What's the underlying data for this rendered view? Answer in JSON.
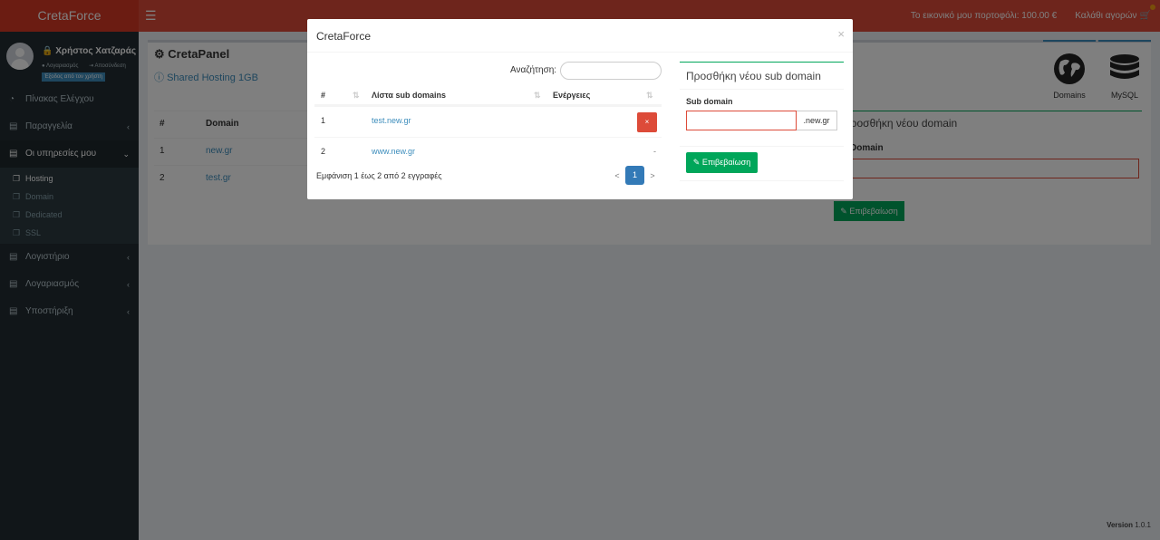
{
  "header": {
    "brand": "CretaForce",
    "portfolio": "Το εικονικό μου πορτοφόλι: 100.00 €",
    "cart": "Καλάθι αγορών"
  },
  "sidebar": {
    "user_name": "Χρήστος Χατζαράς",
    "account_link": "Λογαριασμός",
    "logout_link": "Αποσύνδεση",
    "exit_badge": "Έξοδος από τον χρήστη",
    "items": [
      {
        "label": "Πίνακας Ελέγχου"
      },
      {
        "label": "Παραγγελία"
      },
      {
        "label": "Οι υπηρεσίες μου"
      },
      {
        "label": "Λογιστήριο"
      },
      {
        "label": "Λογαριασμός"
      },
      {
        "label": "Υποστήριξη"
      }
    ],
    "subitems": [
      {
        "label": "Hosting"
      },
      {
        "label": "Domain"
      },
      {
        "label": "Dedicated"
      },
      {
        "label": "SSL"
      }
    ]
  },
  "background": {
    "panel_title": "CretaPanel",
    "panel_subtitle": "Shared Hosting 1GB",
    "table": {
      "col_num": "#",
      "col_domain": "Domain",
      "rows": [
        {
          "num": "1",
          "domain": "new.gr"
        },
        {
          "num": "2",
          "domain": "test.gr"
        }
      ]
    },
    "tiles": [
      {
        "label": "Domains"
      },
      {
        "label": "MySQL"
      }
    ],
    "form_title": "Προσθήκη νέου domain",
    "form_label": "Domain",
    "confirm": "Επιβεβαίωση",
    "version_label": "Version",
    "version_value": "1.0.1"
  },
  "modal": {
    "title": "CretaForce",
    "close": "×",
    "search_label": "Αναζήτηση:",
    "search_value": "",
    "table": {
      "col_num": "#",
      "col_list": "Λίστα sub domains",
      "col_actions": "Ενέργειες",
      "rows": [
        {
          "num": "1",
          "name": "test.new.gr",
          "action": "×"
        },
        {
          "num": "2",
          "name": "www.new.gr",
          "action": "-"
        }
      ]
    },
    "info": "Εμφάνιση 1 έως 2 από 2 εγγραφές",
    "pager": {
      "prev": "<",
      "page": "1",
      "next": ">"
    },
    "add": {
      "title": "Προσθήκη νέου sub domain",
      "label": "Sub domain",
      "value": "",
      "suffix": ".new.gr",
      "confirm": "Επιβεβαίωση"
    }
  }
}
